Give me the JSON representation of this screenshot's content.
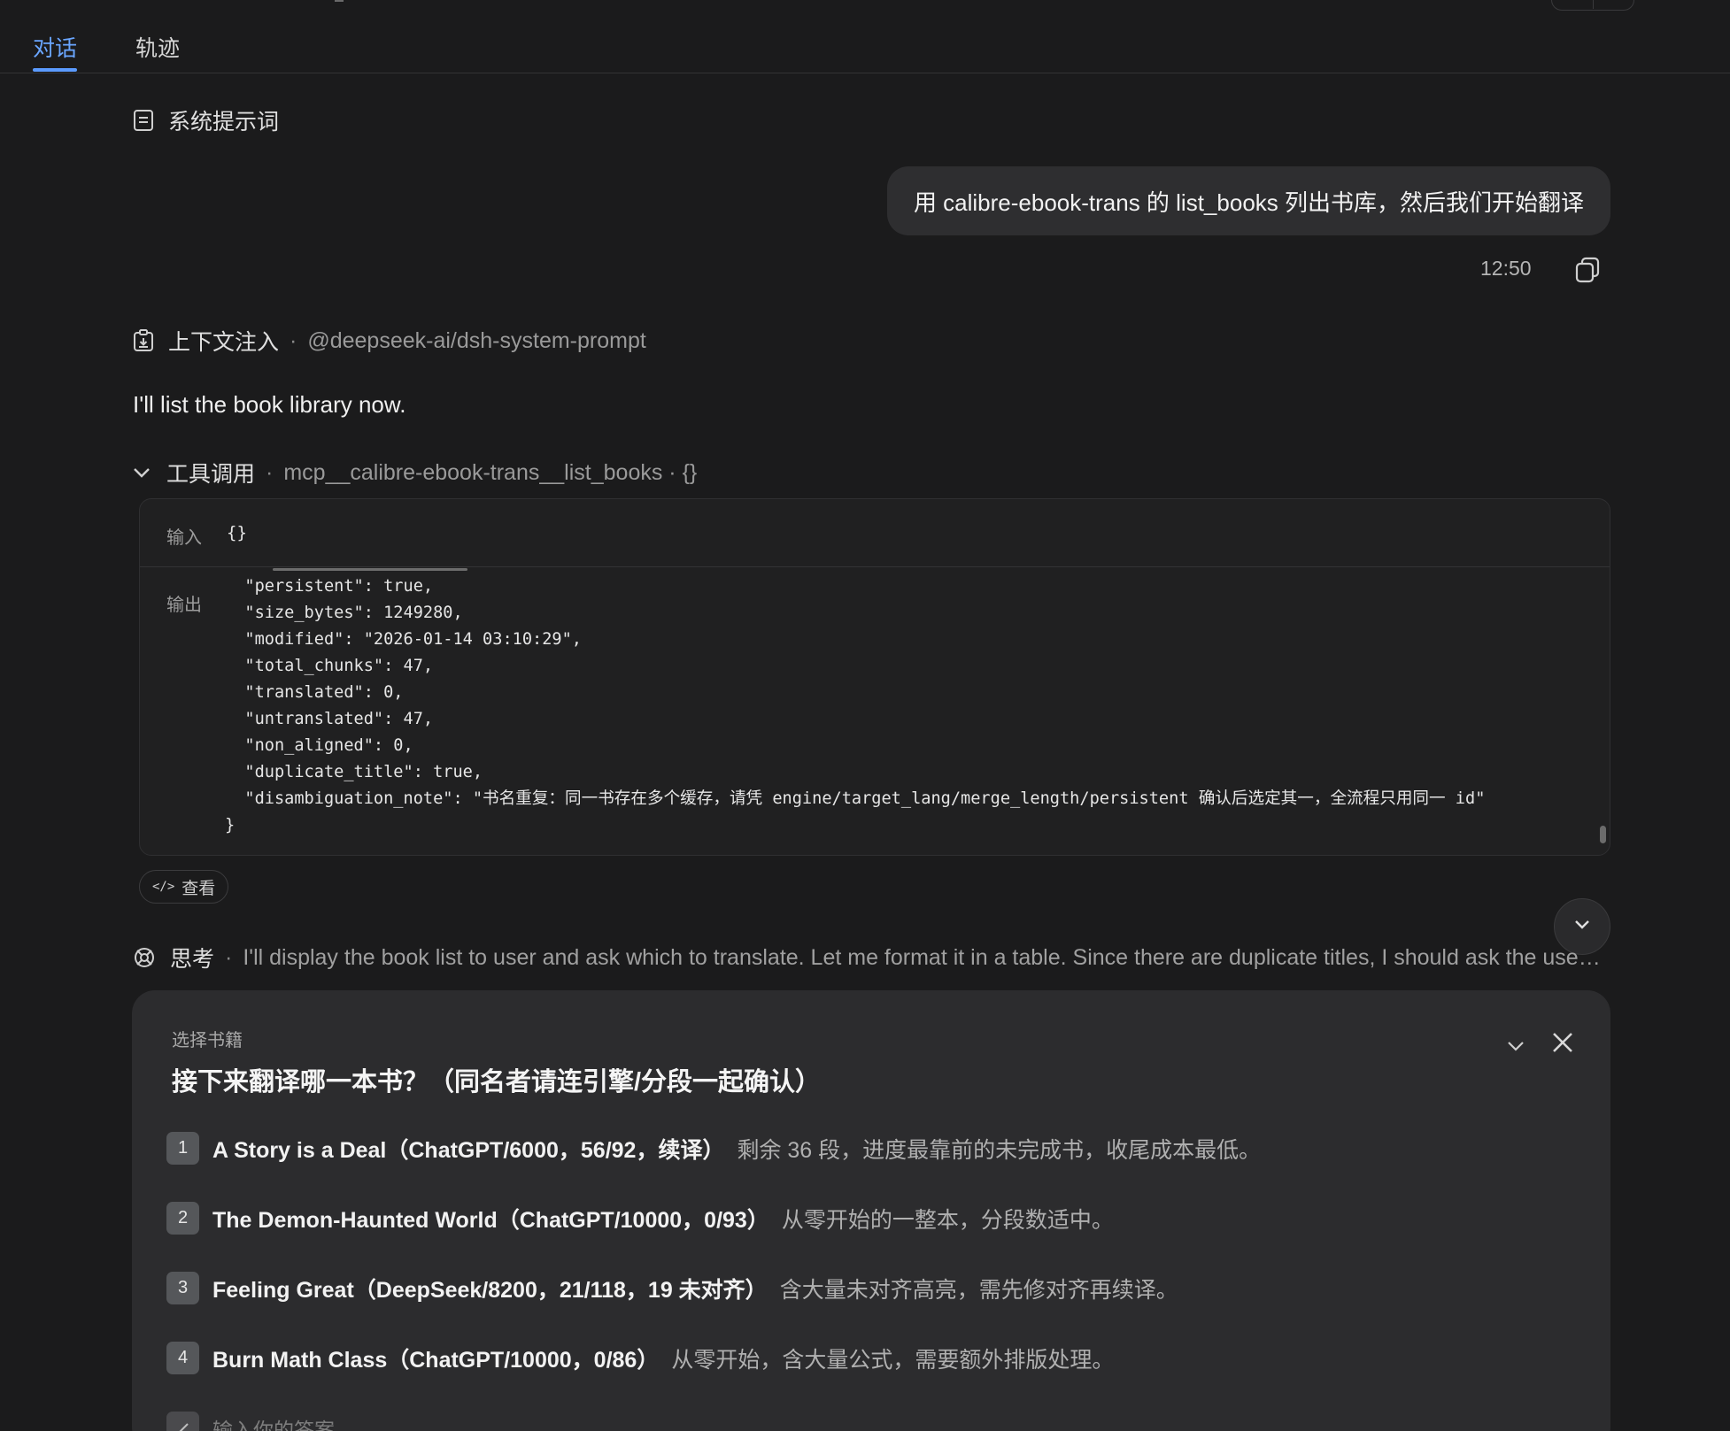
{
  "tabs": [
    {
      "label": "对话",
      "active": true
    },
    {
      "label": "轨迹",
      "active": false
    }
  ],
  "system_prompt": {
    "label": "系统提示词",
    "icon": "document-icon"
  },
  "user_message": {
    "text": "用 calibre-ebook-trans 的 list_books 列出书库，然后我们开始翻译",
    "time": "12:50",
    "copy_icon": "copy-icon"
  },
  "context_injection": {
    "label": "上下文注入",
    "source": "@deepseek-ai/dsh-system-prompt"
  },
  "assistant_text": "I'll list the book library now.",
  "tool_call": {
    "label": "工具调用",
    "name": "mcp__calibre-ebook-trans__list_books · {}",
    "input_label": "输入",
    "input_value": "{}",
    "output_label": "输出",
    "output_lines": [
      "  \"persistent\": true,",
      "  \"size_bytes\": 1249280,",
      "  \"modified\": \"2026-01-14 03:10:29\",",
      "  \"total_chunks\": 47,",
      "  \"translated\": 0,",
      "  \"untranslated\": 47,",
      "  \"non_aligned\": 0,",
      "  \"duplicate_title\": true,",
      "  \"disambiguation_note\": \"书名重复：同一书存在多个缓存，请凭 engine/target_lang/merge_length/persistent 确认后选定其一，全流程只用同一 id\"",
      "}"
    ],
    "view_button": "查看"
  },
  "thinking": {
    "label": "思考",
    "text": "I'll display the book list to user and ask which to translate. Let me format it in a table. Since there are duplicate titles, I should ask the user to c..."
  },
  "question_card": {
    "subtitle": "选择书籍",
    "title": "接下来翻译哪一本书？（同名者请连引擎/分段一起确认）",
    "options": [
      {
        "num": "1",
        "title": "A Story is a Deal（ChatGPT/6000，56/92，续译）",
        "desc": "剩余 36 段，进度最靠前的未完成书，收尾成本最低。"
      },
      {
        "num": "2",
        "title": "The Demon-Haunted World（ChatGPT/10000，0/93）",
        "desc": "从零开始的一整本，分段数适中。"
      },
      {
        "num": "3",
        "title": "Feeling Great（DeepSeek/8200，21/118，19 未对齐）",
        "desc": "含大量未对齐高亮，需先修对齐再续译。"
      },
      {
        "num": "4",
        "title": "Burn Math Class（ChatGPT/10000，0/86）",
        "desc": "从零开始，含大量公式，需要额外排版处理。"
      }
    ],
    "answer_placeholder": "输入你的答案"
  },
  "colors": {
    "background": "#1b1b1c",
    "accent": "#6aa6ff",
    "bubble": "#2e2e30",
    "card": "#2c2c2e"
  }
}
